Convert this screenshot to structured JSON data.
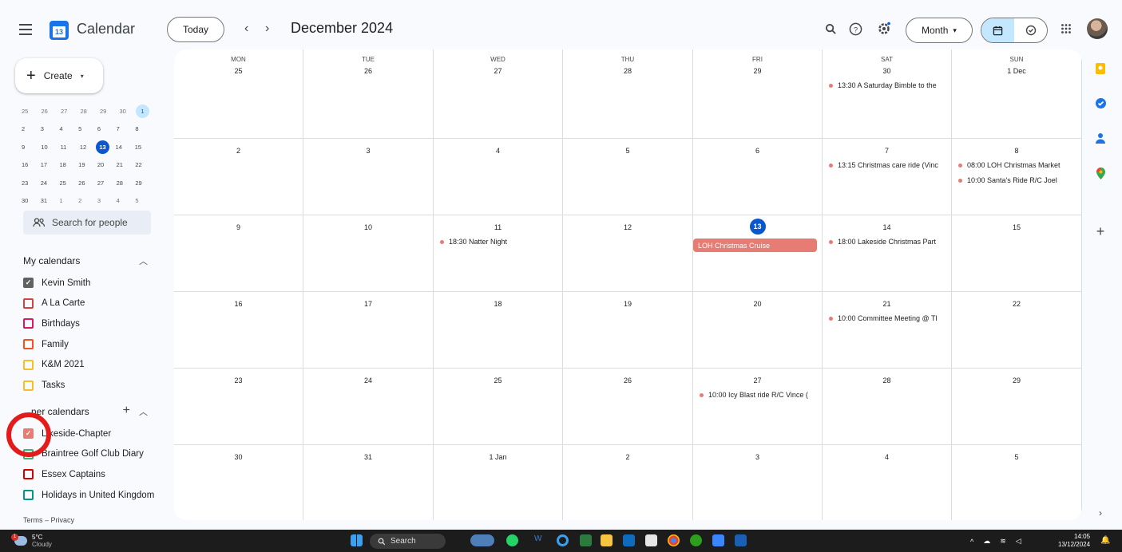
{
  "app": {
    "title": "Calendar",
    "logo_number": "13"
  },
  "header": {
    "today_label": "Today",
    "prev_arrow": "‹",
    "next_arrow": "›",
    "month_title": "December 2024",
    "view_label": "Month",
    "view_caret": "▾"
  },
  "sidebar": {
    "create_label": "Create",
    "mini_calendar": [
      [
        "25",
        "26",
        "27",
        "28",
        "29",
        "30",
        "1"
      ],
      [
        "2",
        "3",
        "4",
        "5",
        "6",
        "7",
        "8"
      ],
      [
        "9",
        "10",
        "11",
        "12",
        "13",
        "14",
        "15"
      ],
      [
        "16",
        "17",
        "18",
        "19",
        "20",
        "21",
        "22"
      ],
      [
        "23",
        "24",
        "25",
        "26",
        "27",
        "28",
        "29"
      ],
      [
        "30",
        "31",
        "1",
        "2",
        "3",
        "4",
        "5"
      ]
    ],
    "search_people_placeholder": "Search for people",
    "my_calendars_label": "My calendars",
    "my_calendars": [
      {
        "name": "Kevin Smith",
        "color": "#616161",
        "checked": true
      },
      {
        "name": "A La Carte",
        "color": "#d2453c",
        "checked": false
      },
      {
        "name": "Birthdays",
        "color": "#d81b60",
        "checked": false
      },
      {
        "name": "Family",
        "color": "#f4511e",
        "checked": false
      },
      {
        "name": "K&M 2021",
        "color": "#f6bf26",
        "checked": false
      },
      {
        "name": "Tasks",
        "color": "#f6bf26",
        "checked": false
      }
    ],
    "other_calendars_label": "ner calendars",
    "other_calendars": [
      {
        "name": "L keside-Chapter",
        "color": "#e67c73",
        "checked": true
      },
      {
        "name": "Braintree Golf Club Diary",
        "color": "#33b679",
        "checked": false
      },
      {
        "name": "Essex Captains",
        "color": "#d50000",
        "checked": false
      },
      {
        "name": "Holidays in United Kingdom",
        "color": "#009688",
        "checked": false
      }
    ],
    "terms": "Terms – Privacy"
  },
  "grid": {
    "weekdays": [
      "MON",
      "TUE",
      "WED",
      "THU",
      "FRI",
      "SAT",
      "SUN"
    ],
    "weeks": [
      [
        {
          "day": "25",
          "events": []
        },
        {
          "day": "26",
          "events": []
        },
        {
          "day": "27",
          "events": []
        },
        {
          "day": "28",
          "events": []
        },
        {
          "day": "29",
          "events": []
        },
        {
          "day": "30",
          "events": [
            "13:30 A Saturday Bimble to the"
          ]
        },
        {
          "day": "1 Dec",
          "events": []
        }
      ],
      [
        {
          "day": "2",
          "events": []
        },
        {
          "day": "3",
          "events": []
        },
        {
          "day": "4",
          "events": []
        },
        {
          "day": "5",
          "events": []
        },
        {
          "day": "6",
          "events": []
        },
        {
          "day": "7",
          "events": [
            "13:15 Christmas care ride (Vinc"
          ]
        },
        {
          "day": "8",
          "events": [
            "08:00 LOH Christmas Market",
            "10:00 Santa's Ride R/C Joel"
          ]
        }
      ],
      [
        {
          "day": "9",
          "events": []
        },
        {
          "day": "10",
          "events": []
        },
        {
          "day": "11",
          "events": [
            "18:30 Natter Night"
          ]
        },
        {
          "day": "12",
          "events": []
        },
        {
          "day": "13",
          "today": true,
          "bar": "LOH Christmas Cruise",
          "events": []
        },
        {
          "day": "14",
          "events": [
            "18:00 Lakeside Christmas Part"
          ]
        },
        {
          "day": "15",
          "events": []
        }
      ],
      [
        {
          "day": "16",
          "events": []
        },
        {
          "day": "17",
          "events": []
        },
        {
          "day": "18",
          "events": []
        },
        {
          "day": "19",
          "events": []
        },
        {
          "day": "20",
          "events": []
        },
        {
          "day": "21",
          "events": [
            "10:00 Committee Meeting @ Tl"
          ]
        },
        {
          "day": "22",
          "events": []
        }
      ],
      [
        {
          "day": "23",
          "events": []
        },
        {
          "day": "24",
          "events": []
        },
        {
          "day": "25",
          "events": []
        },
        {
          "day": "26",
          "events": []
        },
        {
          "day": "27",
          "events": [
            "10:00 Icy Blast ride R/C Vince ("
          ]
        },
        {
          "day": "28",
          "events": []
        },
        {
          "day": "29",
          "events": []
        }
      ],
      [
        {
          "day": "30",
          "events": []
        },
        {
          "day": "31",
          "events": []
        },
        {
          "day": "1 Jan",
          "events": []
        },
        {
          "day": "2",
          "events": []
        },
        {
          "day": "3",
          "events": []
        },
        {
          "day": "4",
          "events": []
        },
        {
          "day": "5",
          "events": []
        }
      ]
    ],
    "event_color": "#e67c73"
  },
  "taskbar": {
    "weather_temp": "5°C",
    "weather_desc": "Cloudy",
    "weather_badge": "1",
    "search_label": "Search",
    "time": "14:05",
    "date": "13/12/2024"
  },
  "colors": {
    "accent": "#0b57d0",
    "today_bg": "#0b57d0",
    "selected_view": "#c2e7ff"
  }
}
